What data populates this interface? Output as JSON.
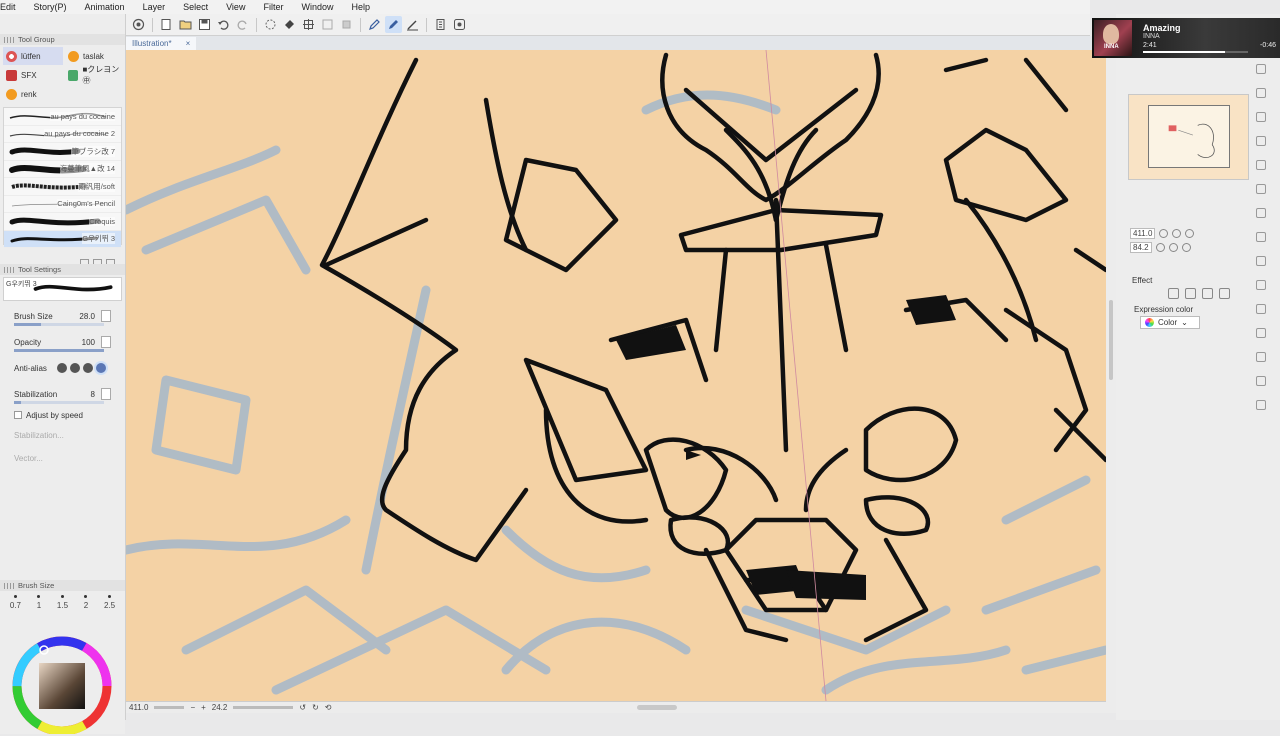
{
  "menu": [
    "Edit",
    "Story(P)",
    "Animation",
    "Layer",
    "Select",
    "View",
    "Filter",
    "Window",
    "Help"
  ],
  "document_tab": {
    "label": "Illustration*",
    "close": "×"
  },
  "tool_group": {
    "title": "Tool Group",
    "items": [
      {
        "label": "lütfen",
        "icon": "gear-icon"
      },
      {
        "label": "taslak",
        "icon": "orange-ball-icon"
      },
      {
        "label": "SFX",
        "icon": "sfx-icon"
      },
      {
        "label": "■クレヨン㊥",
        "icon": "pen-icon"
      },
      {
        "label": "renk",
        "icon": "orange-ball-icon"
      }
    ]
  },
  "brushes": [
    {
      "name": "au pays du cocaine"
    },
    {
      "name": "au pays du cocaine 2"
    },
    {
      "name": "筆ブラシ改 7"
    },
    {
      "name": "海蔓筆風▲改 14"
    },
    {
      "name": "雨汎用/soft"
    },
    {
      "name": "Caing0m's Pencil"
    },
    {
      "name": "Croquis"
    },
    {
      "name": "G우키뛰 3"
    }
  ],
  "tool_settings": {
    "title": "Tool Settings",
    "preview_name": "G우키뛰 3",
    "brush_size_label": "Brush Size",
    "brush_size_value": "28.0",
    "opacity_label": "Opacity",
    "opacity_value": "100",
    "antialias_label": "Anti-alias",
    "stabilization_label": "Stabilization",
    "stabilization_value": "8",
    "adjust_by_speed_label": "Adjust by speed",
    "stabilization_speed_label": "Stabilization...",
    "vector_label": "Vector..."
  },
  "brush_size_panel": {
    "title": "Brush Size",
    "sizes": [
      "0.7",
      "1",
      "1.5",
      "2",
      "2.5"
    ]
  },
  "status_bar": {
    "zoom": "411.0",
    "angle": "24.2"
  },
  "navigator": {
    "zoom": "411.0",
    "angle": "84.2"
  },
  "effect": {
    "label": "Effect",
    "expression_color_label": "Expression color",
    "expression_color_value": "Color"
  },
  "media": {
    "title": "Amazing",
    "artist": "INNA",
    "elapsed": "2:41",
    "remaining": "-0:46",
    "art_text": "INNA",
    "progress": 0.78
  },
  "colors": {
    "canvas": "#f4d2a5",
    "sketch_blue": "#a9b9c9",
    "line_black": "#111111",
    "accent": "#5b77b5"
  }
}
